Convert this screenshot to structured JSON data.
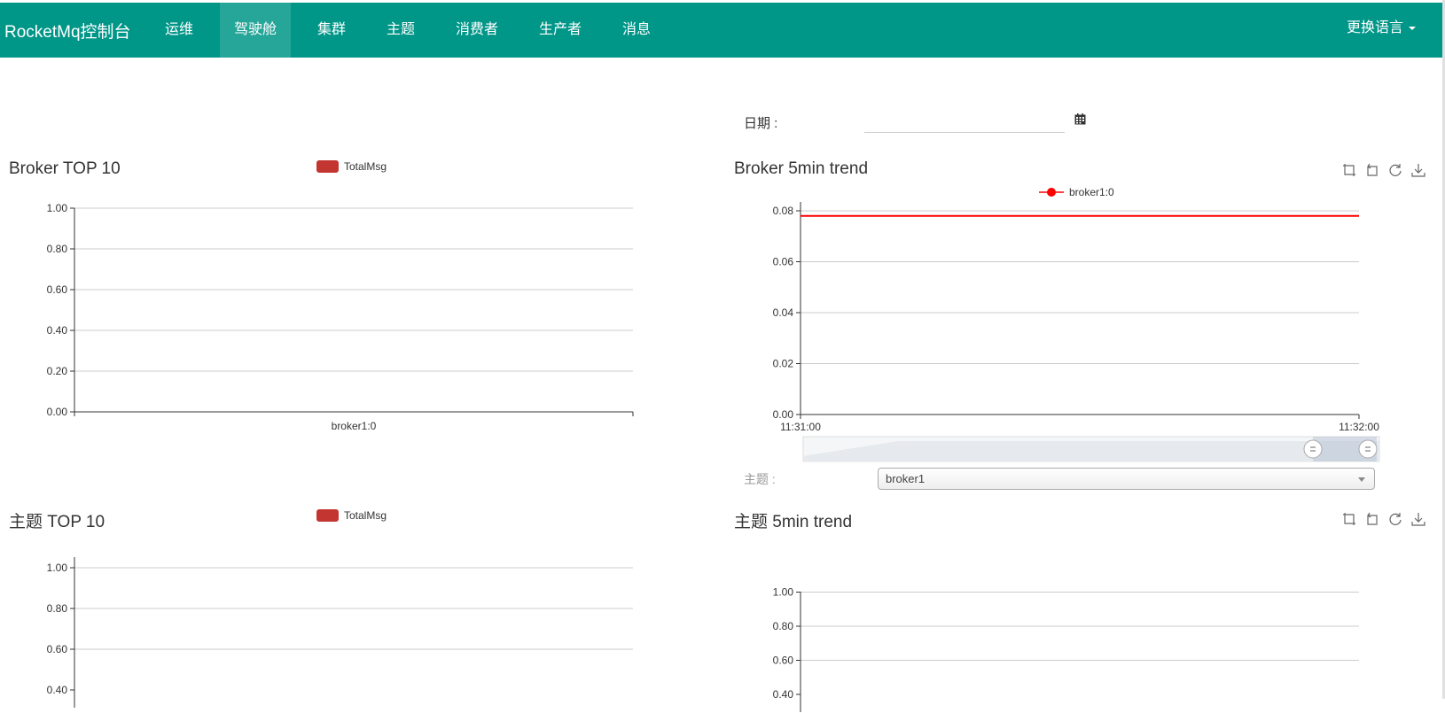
{
  "header": {
    "brand": "RocketMq控制台",
    "nav": [
      {
        "label": "运维",
        "active": false
      },
      {
        "label": "驾驶舱",
        "active": true
      },
      {
        "label": "集群",
        "active": false
      },
      {
        "label": "主题",
        "active": false
      },
      {
        "label": "消费者",
        "active": false
      },
      {
        "label": "生产者",
        "active": false
      },
      {
        "label": "消息",
        "active": false
      }
    ],
    "language": "更换语言",
    "colors": {
      "bar": "#009688",
      "text": "#ffffff"
    }
  },
  "date_filter": {
    "label": "日期 :",
    "value": "",
    "icon": "calendar-icon"
  },
  "topic_filter": {
    "label": "主题 :",
    "selected": "broker1"
  },
  "toolbox_icons": [
    "zoom-icon",
    "zoom-reset-icon",
    "restore-icon",
    "save-image-icon"
  ],
  "panels": {
    "broker_top10": {
      "title": "Broker TOP 10",
      "legend": "TotalMsg"
    },
    "broker_trend": {
      "title": "Broker 5min trend",
      "legend": "broker1:0"
    },
    "topic_top10": {
      "title": "主题 TOP 10",
      "legend": "TotalMsg"
    },
    "topic_trend": {
      "title": "主题 5min trend"
    }
  },
  "chart_data": [
    {
      "type": "bar",
      "title": "Broker TOP 10",
      "categories": [
        "broker1:0"
      ],
      "series": [
        {
          "name": "TotalMsg",
          "values": [
            0
          ]
        }
      ],
      "yticks": [
        "0.00",
        "0.20",
        "0.40",
        "0.60",
        "0.80",
        "1.00"
      ],
      "ylim": [
        0,
        1
      ],
      "grid": true,
      "legend": "top",
      "color": "#c23531"
    },
    {
      "type": "line",
      "title": "Broker 5min trend",
      "x": [
        "11:31:00",
        "11:32:00"
      ],
      "series": [
        {
          "name": "broker1:0",
          "values": [
            0.078,
            0.078
          ]
        }
      ],
      "yticks": [
        "0.00",
        "0.02",
        "0.04",
        "0.06",
        "0.08"
      ],
      "ylim": [
        0,
        0.08
      ],
      "grid": true,
      "legend": "top",
      "color": "#ff0000"
    },
    {
      "type": "bar",
      "title": "主题 TOP 10",
      "categories": [],
      "series": [
        {
          "name": "TotalMsg",
          "values": []
        }
      ],
      "yticks": [
        "0.40",
        "0.60",
        "0.80",
        "1.00"
      ],
      "ylim": [
        0,
        1
      ],
      "grid": true,
      "legend": "top",
      "color": "#c23531"
    },
    {
      "type": "line",
      "title": "主题 5min trend",
      "x": [],
      "series": [],
      "yticks": [
        "0.40",
        "0.60",
        "0.80",
        "1.00"
      ],
      "ylim": [
        0,
        1
      ],
      "grid": true
    }
  ]
}
